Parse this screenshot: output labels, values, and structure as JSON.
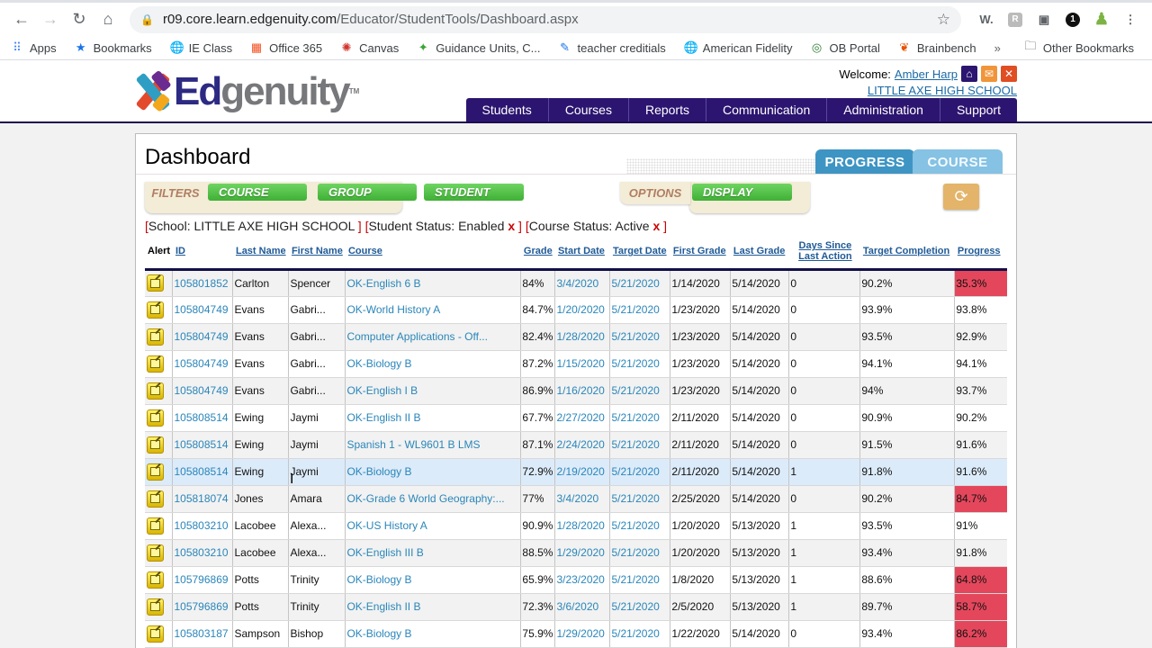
{
  "browser": {
    "url_host": "r09.core.learn.edgenuity.com",
    "url_path": "/Educator/StudentTools/Dashboard.aspx",
    "bookmarks": [
      {
        "label": "Apps",
        "icon": "apps-grid-icon"
      },
      {
        "label": "Bookmarks",
        "icon": "star-icon"
      },
      {
        "label": "IE Class",
        "icon": "globe-icon"
      },
      {
        "label": "Office 365",
        "icon": "office-icon"
      },
      {
        "label": "Canvas",
        "icon": "canvas-icon"
      },
      {
        "label": "Guidance Units, C...",
        "icon": "guidance-icon"
      },
      {
        "label": "teacher creditials",
        "icon": "pencil-icon"
      },
      {
        "label": "American Fidelity",
        "icon": "globe-icon"
      },
      {
        "label": "OB Portal",
        "icon": "ob-portal-icon"
      },
      {
        "label": "Brainbench",
        "icon": "brainbench-icon"
      }
    ],
    "more_bookmarks": "»",
    "other_bookmarks": "Other Bookmarks",
    "extension_badge": "1"
  },
  "header": {
    "logo_ed": "Ed",
    "logo_rest": "genuity",
    "logo_tm": "TM",
    "welcome_label": "Welcome:",
    "user_name": "Amber Harp",
    "school_name": "LITTLE AXE HIGH SCHOOL",
    "nav": [
      "Students",
      "Courses",
      "Reports",
      "Communication",
      "Administration",
      "Support"
    ]
  },
  "dashboard": {
    "title": "Dashboard",
    "view_tabs": [
      "PROGRESS",
      "COURSE"
    ],
    "active_view": "PROGRESS",
    "filters_label": "FILTERS",
    "filter_buttons": [
      "COURSE",
      "GROUP",
      "STUDENT"
    ],
    "options_label": "OPTIONS",
    "options_buttons": [
      "DISPLAY"
    ],
    "active_filters": [
      {
        "text": "School: LITTLE AXE HIGH SCHOOL ",
        "removable": false
      },
      {
        "text": "Student Status: Enabled ",
        "removable": true
      },
      {
        "text": "Course Status: Active ",
        "removable": true
      }
    ],
    "remove_glyph": "x",
    "colors": {
      "low_progress": "#e4475c",
      "link": "#2a86b9",
      "nav": "#2c1570"
    }
  },
  "table": {
    "columns": [
      "Alert",
      "ID",
      "Last Name",
      "First Name",
      "Course",
      "Grade",
      "Start Date",
      "Target Date",
      "First Grade",
      "Last Grade",
      "Days Since",
      "Last Action",
      "Target Completion",
      "Progress"
    ],
    "rows": [
      {
        "id": "105801852",
        "last": "Carlton",
        "first": "Spencer",
        "course": "OK-English 6 B",
        "grade": "84%",
        "start": "3/4/2020",
        "target": "5/21/2020",
        "first_grade": "1/14/2020",
        "last_grade": "5/14/2020",
        "days": "0",
        "target_completion": "90.2%",
        "progress": "35.3%",
        "low": true
      },
      {
        "id": "105804749",
        "last": "Evans",
        "first": "Gabri...",
        "course": "OK-World History A",
        "grade": "84.7%",
        "start": "1/20/2020",
        "target": "5/21/2020",
        "first_grade": "1/23/2020",
        "last_grade": "5/14/2020",
        "days": "0",
        "target_completion": "93.9%",
        "progress": "93.8%",
        "low": false
      },
      {
        "id": "105804749",
        "last": "Evans",
        "first": "Gabri...",
        "course": "Computer Applications - Off...",
        "grade": "82.4%",
        "start": "1/28/2020",
        "target": "5/21/2020",
        "first_grade": "1/23/2020",
        "last_grade": "5/14/2020",
        "days": "0",
        "target_completion": "93.5%",
        "progress": "92.9%",
        "low": false
      },
      {
        "id": "105804749",
        "last": "Evans",
        "first": "Gabri...",
        "course": "OK-Biology B",
        "grade": "87.2%",
        "start": "1/15/2020",
        "target": "5/21/2020",
        "first_grade": "1/23/2020",
        "last_grade": "5/14/2020",
        "days": "0",
        "target_completion": "94.1%",
        "progress": "94.1%",
        "low": false
      },
      {
        "id": "105804749",
        "last": "Evans",
        "first": "Gabri...",
        "course": "OK-English I B",
        "grade": "86.9%",
        "start": "1/16/2020",
        "target": "5/21/2020",
        "first_grade": "1/23/2020",
        "last_grade": "5/14/2020",
        "days": "0",
        "target_completion": "94%",
        "progress": "93.7%",
        "low": false
      },
      {
        "id": "105808514",
        "last": "Ewing",
        "first": "Jaymi",
        "course": "OK-English II B",
        "grade": "67.7%",
        "start": "2/27/2020",
        "target": "5/21/2020",
        "first_grade": "2/11/2020",
        "last_grade": "5/14/2020",
        "days": "0",
        "target_completion": "90.9%",
        "progress": "90.2%",
        "low": false
      },
      {
        "id": "105808514",
        "last": "Ewing",
        "first": "Jaymi",
        "course": "Spanish 1 - WL9601 B LMS",
        "grade": "87.1%",
        "start": "2/24/2020",
        "target": "5/21/2020",
        "first_grade": "2/11/2020",
        "last_grade": "5/14/2020",
        "days": "0",
        "target_completion": "91.5%",
        "progress": "91.6%",
        "low": false
      },
      {
        "id": "105808514",
        "last": "Ewing",
        "first": "Jaymi",
        "course": "OK-Biology B",
        "grade": "72.9%",
        "start": "2/19/2020",
        "target": "5/21/2020",
        "first_grade": "2/11/2020",
        "last_grade": "5/14/2020",
        "days": "1",
        "target_completion": "91.8%",
        "progress": "91.6%",
        "low": false,
        "hovered": true
      },
      {
        "id": "105818074",
        "last": "Jones",
        "first": "Amara",
        "course": "OK-Grade 6 World Geography:...",
        "grade": "77%",
        "start": "3/4/2020",
        "target": "5/21/2020",
        "first_grade": "2/25/2020",
        "last_grade": "5/14/2020",
        "days": "0",
        "target_completion": "90.2%",
        "progress": "84.7%",
        "low": true
      },
      {
        "id": "105803210",
        "last": "Lacobee",
        "first": "Alexa...",
        "course": "OK-US History A",
        "grade": "90.9%",
        "start": "1/28/2020",
        "target": "5/21/2020",
        "first_grade": "1/20/2020",
        "last_grade": "5/13/2020",
        "days": "1",
        "target_completion": "93.5%",
        "progress": "91%",
        "low": false
      },
      {
        "id": "105803210",
        "last": "Lacobee",
        "first": "Alexa...",
        "course": "OK-English III B",
        "grade": "88.5%",
        "start": "1/29/2020",
        "target": "5/21/2020",
        "first_grade": "1/20/2020",
        "last_grade": "5/13/2020",
        "days": "1",
        "target_completion": "93.4%",
        "progress": "91.8%",
        "low": false
      },
      {
        "id": "105796869",
        "last": "Potts",
        "first": "Trinity",
        "course": "OK-Biology B",
        "grade": "65.9%",
        "start": "3/23/2020",
        "target": "5/21/2020",
        "first_grade": "1/8/2020",
        "last_grade": "5/13/2020",
        "days": "1",
        "target_completion": "88.6%",
        "progress": "64.8%",
        "low": true
      },
      {
        "id": "105796869",
        "last": "Potts",
        "first": "Trinity",
        "course": "OK-English II B",
        "grade": "72.3%",
        "start": "3/6/2020",
        "target": "5/21/2020",
        "first_grade": "2/5/2020",
        "last_grade": "5/13/2020",
        "days": "1",
        "target_completion": "89.7%",
        "progress": "58.7%",
        "low": true
      },
      {
        "id": "105803187",
        "last": "Sampson",
        "first": "Bishop",
        "course": "OK-Biology B",
        "grade": "75.9%",
        "start": "1/29/2020",
        "target": "5/21/2020",
        "first_grade": "1/22/2020",
        "last_grade": "5/14/2020",
        "days": "0",
        "target_completion": "93.4%",
        "progress": "86.2%",
        "low": true
      }
    ]
  }
}
